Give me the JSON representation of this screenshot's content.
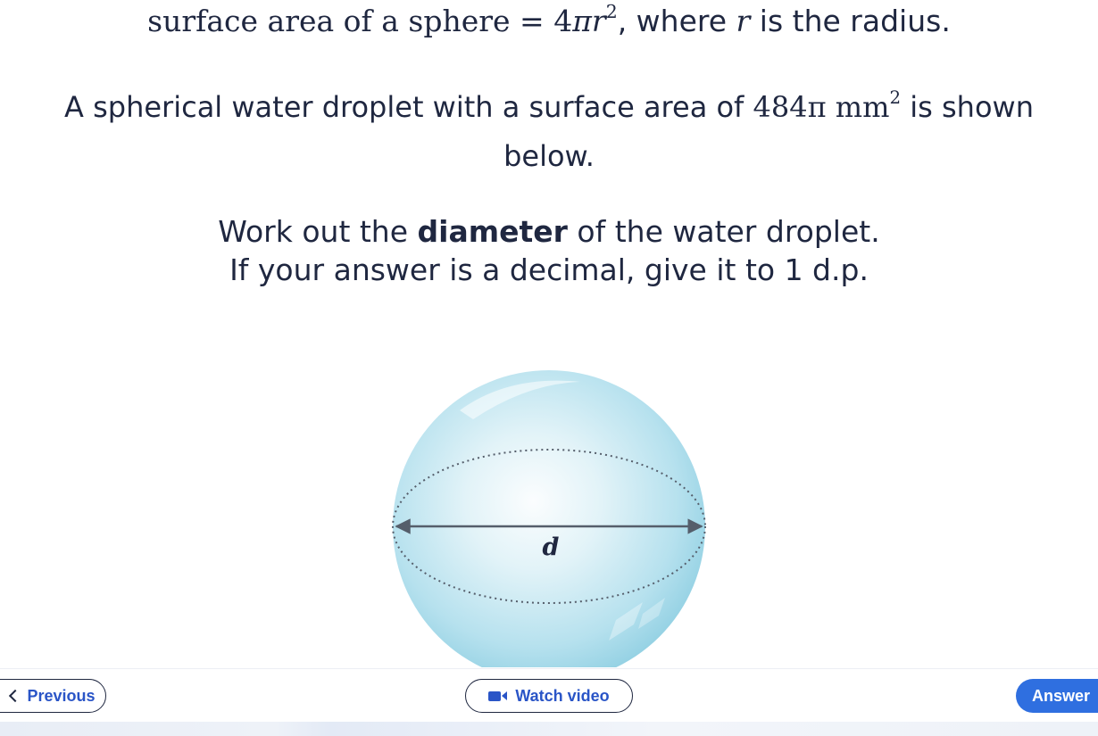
{
  "question": {
    "line1": {
      "formula_prefix": "surface area of a sphere",
      "equals": " = 4",
      "pi": "π",
      "r": "r",
      "exp": "2",
      "sep": ", where ",
      "r2": "r",
      "suffix": " is the radius."
    },
    "line2": {
      "prefix": "A spherical water droplet with a surface area of ",
      "value": "484π mm",
      "exp": "2",
      "suffix": " is shown"
    },
    "line3": "below.",
    "line4": {
      "prefix": "Work out the ",
      "bold": "diameter",
      "suffix": " of the water droplet."
    },
    "line5": "If your answer is a decimal, give it to 1 d.p."
  },
  "diagram": {
    "label": "d",
    "sphere_color": "#8fcfe2"
  },
  "nav": {
    "previous": "Previous",
    "watch_video": "Watch video",
    "answer": "Answer"
  },
  "colors": {
    "text": "#1f2740",
    "link": "#2a55c7",
    "primary": "#2f6fe0"
  }
}
